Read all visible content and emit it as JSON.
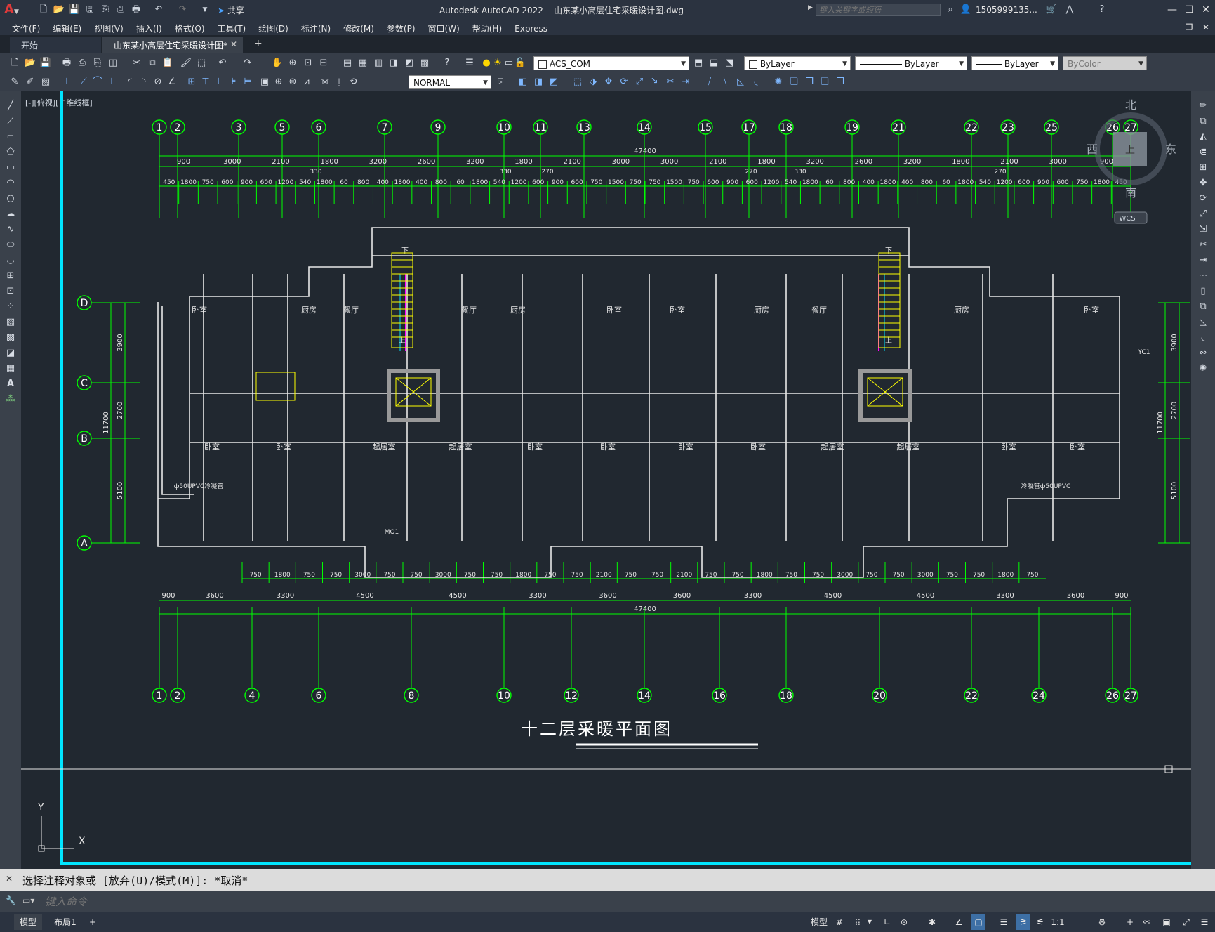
{
  "app": {
    "title": "Autodesk AutoCAD 2022",
    "document": "山东某小高层住宅采暖设计图.dwg",
    "share_label": "共享",
    "search_placeholder": "键入关键字或短语",
    "user": "1505999135...",
    "window_controls": [
      "minimize-icon",
      "restore-icon",
      "close-icon"
    ]
  },
  "menu": [
    "文件(F)",
    "编辑(E)",
    "视图(V)",
    "插入(I)",
    "格式(O)",
    "工具(T)",
    "绘图(D)",
    "标注(N)",
    "修改(M)",
    "参数(P)",
    "窗口(W)",
    "帮助(H)",
    "Express"
  ],
  "tabs": [
    {
      "label": "开始",
      "active": false
    },
    {
      "label": "山东某小高层住宅采暖设计图*",
      "active": true
    }
  ],
  "toolbar": {
    "layer": "ACS_COM",
    "color": "ByLayer",
    "linetype": "ByLayer",
    "lineweight": "ByLayer",
    "plotstyle": "ByColor",
    "dimstyle": "NORMAL"
  },
  "viewport_label": "[-][俯视][二维线框]",
  "viewcube": {
    "n": "北",
    "s": "南",
    "w": "西",
    "e": "东",
    "top": "上",
    "wcs": "WCS"
  },
  "drawing": {
    "title": "十二层采暖平面图",
    "top_axes": [
      "1",
      "2",
      "3",
      "5",
      "6",
      "7",
      "9",
      "10",
      "11",
      "13",
      "14",
      "15",
      "17",
      "18",
      "19",
      "21",
      "22",
      "23",
      "25",
      "26",
      "27"
    ],
    "bottom_axes": [
      "1",
      "2",
      "4",
      "6",
      "8",
      "10",
      "12",
      "14",
      "16",
      "18",
      "20",
      "22",
      "24",
      "26",
      "27"
    ],
    "row_axes": [
      "D",
      "C",
      "B",
      "A"
    ],
    "total_width": "47400",
    "top_dim_row1": [
      "900",
      "3000",
      "2100",
      "1800",
      "3200",
      "2600",
      "3200",
      "1800",
      "2100",
      "3000",
      "3000",
      "2100",
      "1800",
      "3200",
      "2600",
      "3200",
      "1800",
      "2100",
      "3000",
      "900"
    ],
    "top_dim_row2": [
      "450",
      "1800",
      "750",
      "600",
      "900",
      "600",
      "1200",
      "540",
      "1800",
      "60",
      "800",
      "400",
      "1800",
      "400",
      "800",
      "60",
      "1800",
      "540",
      "1200",
      "600",
      "900",
      "600",
      "750",
      "1500",
      "750",
      "750",
      "1500",
      "750",
      "600",
      "900",
      "600",
      "1200",
      "540",
      "1800",
      "60",
      "800",
      "400",
      "1800",
      "400",
      "800",
      "60",
      "1800",
      "540",
      "1200",
      "600",
      "900",
      "600",
      "750",
      "1800",
      "450"
    ],
    "top_dim_small": [
      "330",
      "330",
      "270",
      "270",
      "330",
      "270"
    ],
    "bottom_dim_row1": [
      "750",
      "1800",
      "750",
      "750",
      "3000",
      "750",
      "750",
      "3000",
      "750",
      "750",
      "1800",
      "750",
      "750",
      "2100",
      "750",
      "750",
      "2100",
      "750",
      "750",
      "1800",
      "750",
      "750",
      "3000",
      "750",
      "750",
      "3000",
      "750",
      "750",
      "1800",
      "750"
    ],
    "bottom_dim_row2": [
      "900",
      "3600",
      "3300",
      "4500",
      "4500",
      "3300",
      "3600",
      "3600",
      "3300",
      "4500",
      "4500",
      "3300",
      "3600",
      "900"
    ],
    "side_dims": [
      "3900",
      "2700",
      "5100"
    ],
    "side_total": "11700",
    "rooms_upper": [
      "卧室",
      "厨房",
      "餐厅",
      "餐厅",
      "厨房",
      "卧室",
      "卧室",
      "厨房",
      "餐厅",
      "厨房",
      "卧室"
    ],
    "rooms_lower": [
      "卧室",
      "卧室",
      "起居室",
      "起居室",
      "卧室",
      "卧室",
      "卧室",
      "卧室",
      "起居室",
      "起居室",
      "卧室",
      "卧室"
    ],
    "stair_up": "上",
    "stair_down": "下",
    "pipe_note_left": "ф50UPVC冷凝管",
    "pipe_note_right": "冷凝管ф50UPVC",
    "mark_mq": "MQ1",
    "mark_yc": "YC1",
    "ucs_y": "Y",
    "ucs_x": "X"
  },
  "command": {
    "history": "选择注释对象或 [放弃(U)/模式(M)]: *取消*",
    "placeholder": "键入命令"
  },
  "layout_tabs": [
    "模型",
    "布局1"
  ],
  "status": {
    "model": "模型",
    "scale": "1:1"
  },
  "colors": {
    "bg": "#212830",
    "grid": "#00ff00",
    "wall": "#ffffff",
    "cyan": "#00e5ff",
    "yellow": "#ffff00",
    "magenta": "#ff00ff"
  }
}
